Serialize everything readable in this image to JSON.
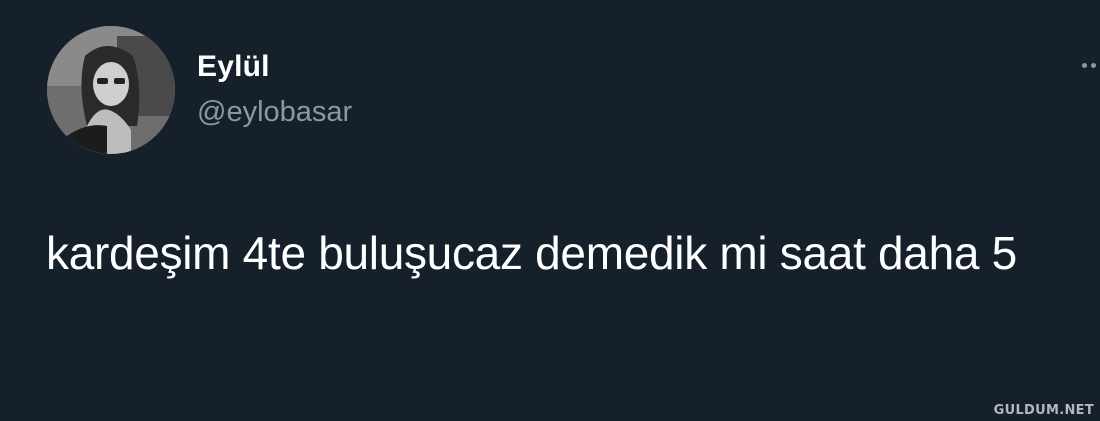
{
  "tweet": {
    "author": {
      "display_name": "Eylül",
      "handle": "@eylobasar",
      "avatar_icon": "profile-photo"
    },
    "text": "kardeşim 4te buluşucaz demedik mi saat daha 5",
    "more_icon": "more-dots-icon"
  },
  "watermark": "GULDUM.NET",
  "colors": {
    "background": "#15202b",
    "primary_text": "#ffffff",
    "secondary_text": "#8899a6"
  }
}
